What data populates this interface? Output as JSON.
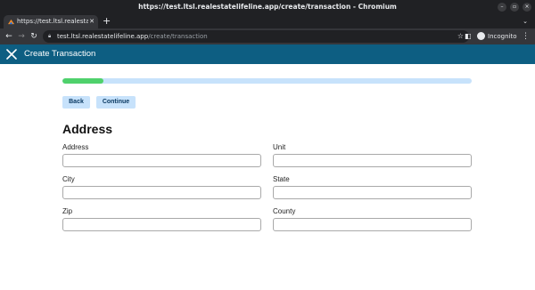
{
  "browser": {
    "window_title": "https://test.ltsl.realestatelifeline.app/create/transaction - Chromium",
    "tab_title": "https://test.ltsl.realestat",
    "url_host": "test.ltsl.realestatelifeline.app",
    "url_path": "/create/transaction",
    "profile_label": "Incognito"
  },
  "app": {
    "header_title": "Create Transaction",
    "progress": 0.1,
    "colors": {
      "header": "#0d5e82",
      "progress_fill": "#4fd16c",
      "progress_track": "#c7e2fb",
      "button_bg": "#c7e2fb"
    },
    "buttons": {
      "back": "Back",
      "continue": "Continue"
    },
    "section_title": "Address",
    "fields": {
      "address": {
        "label": "Address",
        "value": ""
      },
      "unit": {
        "label": "Unit",
        "value": ""
      },
      "city": {
        "label": "City",
        "value": ""
      },
      "state": {
        "label": "State",
        "value": ""
      },
      "zip": {
        "label": "Zip",
        "value": ""
      },
      "county": {
        "label": "County",
        "value": ""
      }
    }
  }
}
